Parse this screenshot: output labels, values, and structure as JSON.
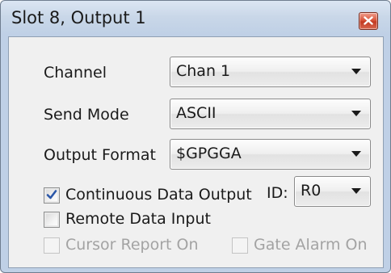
{
  "window": {
    "title": "Slot 8, Output 1"
  },
  "fields": {
    "channel": {
      "label": "Channel",
      "value": "Chan 1"
    },
    "send_mode": {
      "label": "Send Mode",
      "value": "ASCII"
    },
    "output_format": {
      "label": "Output Format",
      "value": "$GPGGA"
    },
    "id": {
      "label": "ID:",
      "value": "R0"
    }
  },
  "checkboxes": {
    "continuous_data_output": {
      "label": "Continuous Data Output",
      "checked": true,
      "enabled": true
    },
    "remote_data_input": {
      "label": "Remote Data Input",
      "checked": false,
      "enabled": true
    },
    "cursor_report_on": {
      "label": "Cursor Report On",
      "checked": false,
      "enabled": false
    },
    "gate_alarm_on": {
      "label": "Gate Alarm On",
      "checked": false,
      "enabled": false
    }
  },
  "icons": {
    "close": "close-icon",
    "dropdown": "chevron-down-icon",
    "check": "checkmark-icon"
  },
  "colors": {
    "title_bar": "#c9d7e8",
    "client_bg": "#f0f0f0",
    "close_button": "#c94a32",
    "check_mark": "#2b57a8",
    "disabled_text": "#a3a3a3"
  }
}
